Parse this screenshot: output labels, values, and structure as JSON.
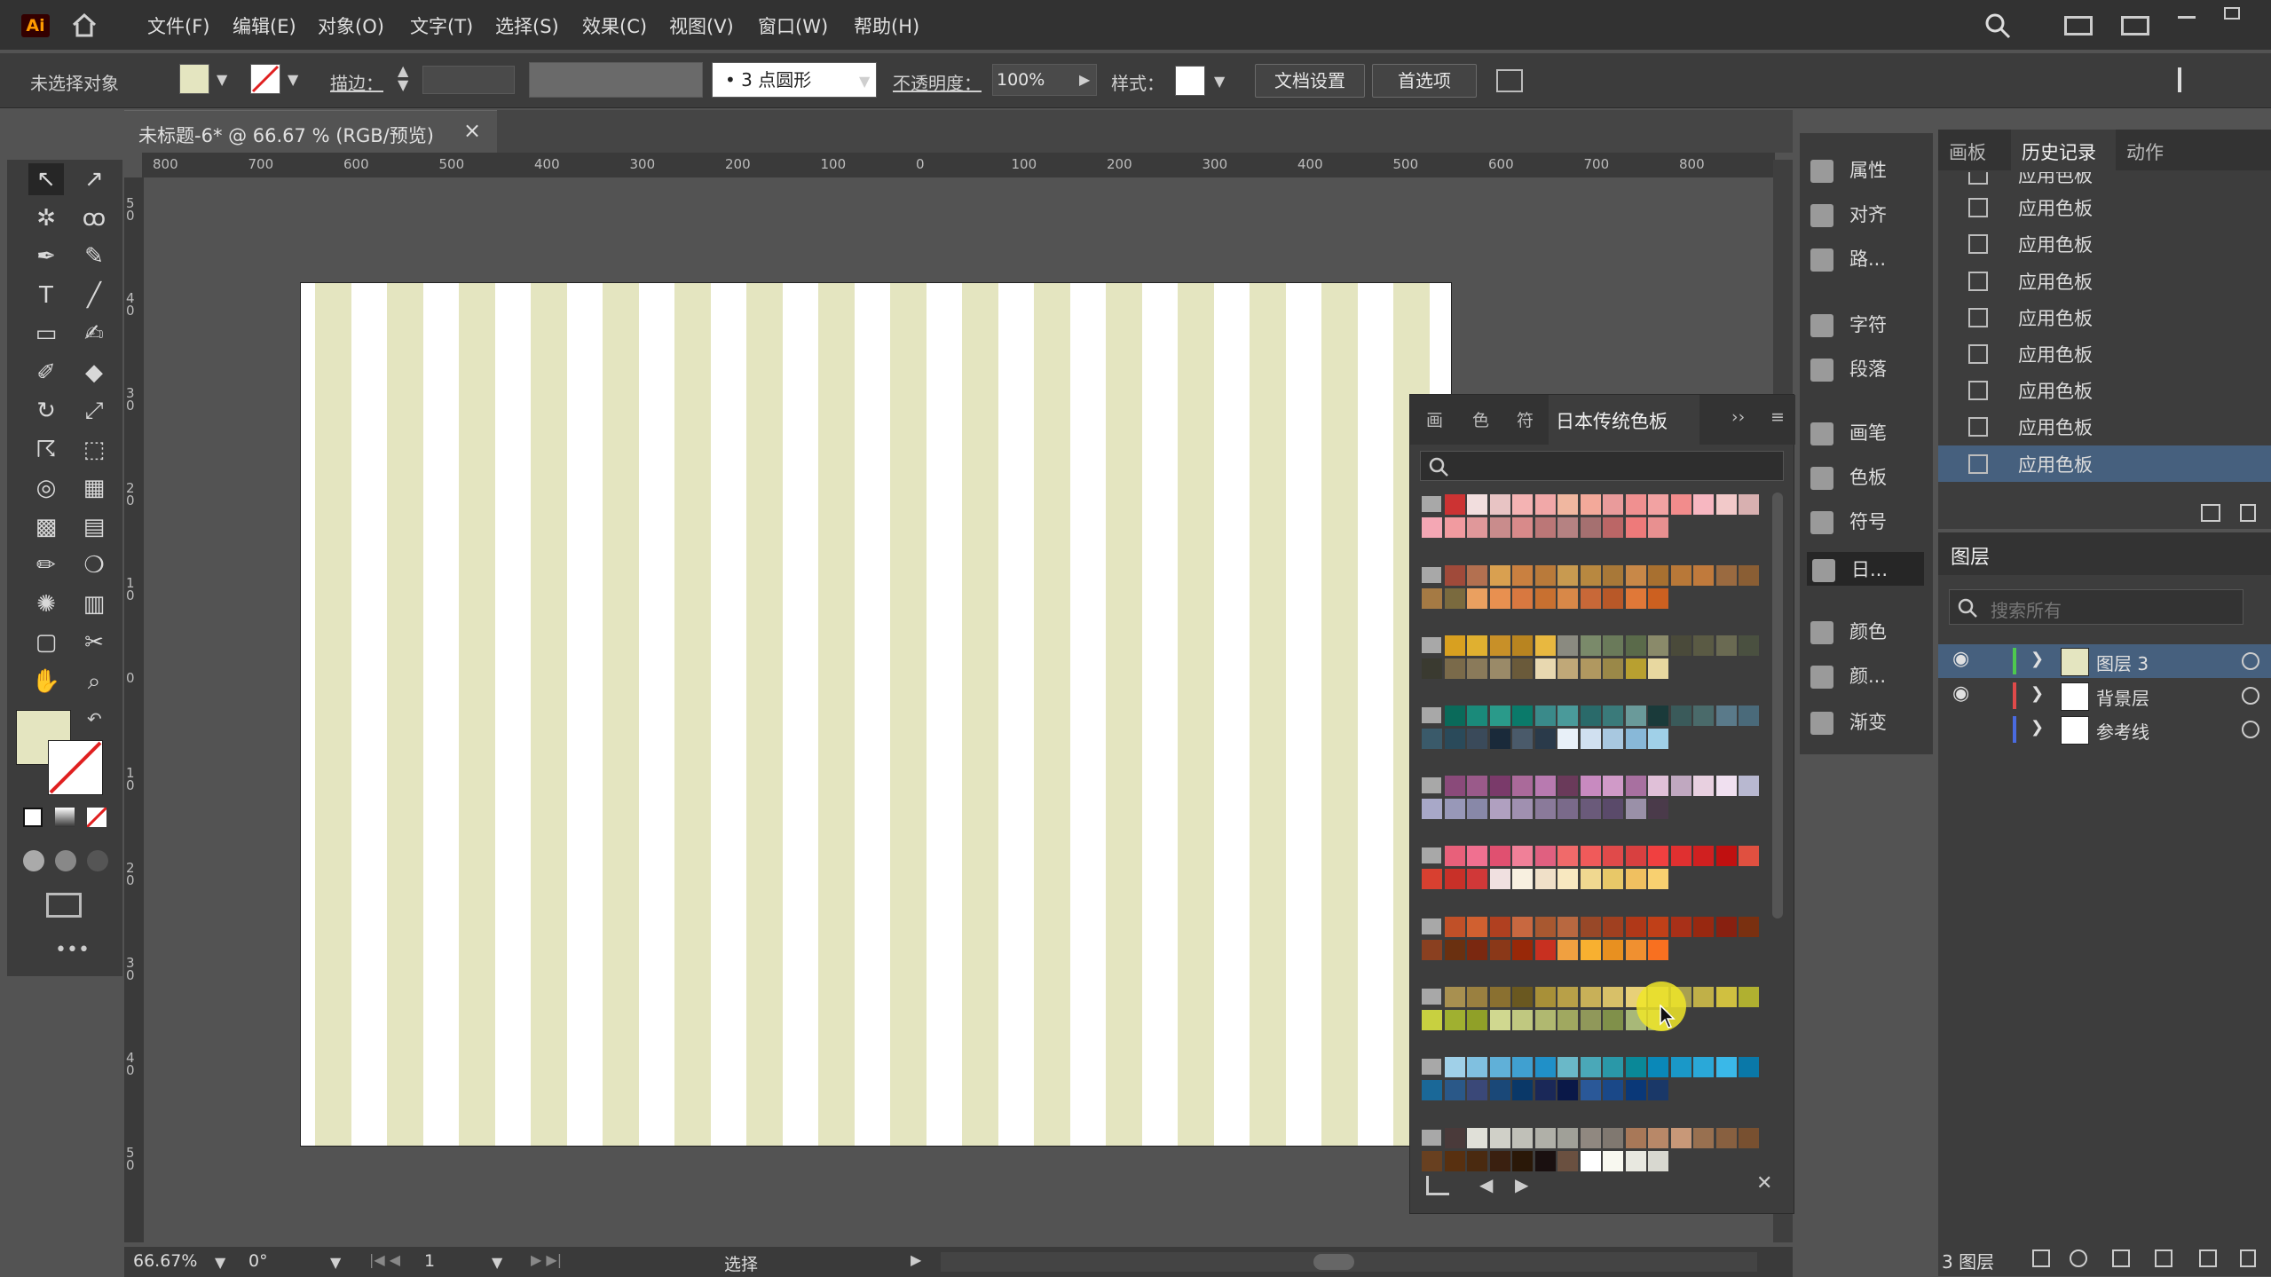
{
  "menubar": {
    "logo": "Ai",
    "items": [
      "文件(F)",
      "编辑(E)",
      "对象(O)",
      "文字(T)",
      "选择(S)",
      "效果(C)",
      "视图(V)",
      "窗口(W)",
      "帮助(H)"
    ]
  },
  "control_bar": {
    "no_selection": "未选择对象",
    "stroke_label": "描边：",
    "brush_label": "3 点圆形",
    "opacity_label": "不透明度：",
    "opacity_value": "100%",
    "style_label": "样式：",
    "doc_setup": "文档设置",
    "preferences": "首选项"
  },
  "document": {
    "tab_title": "未标题-6* @ 66.67 % (RGB/预览)",
    "close": "×",
    "ruler_top_labels": [
      "800",
      "700",
      "600",
      "500",
      "400",
      "300",
      "200",
      "100",
      "0",
      "100",
      "200",
      "300",
      "400",
      "500",
      "600",
      "700",
      "800"
    ],
    "ruler_left_labels": [
      "5 0",
      "4 0",
      "3 0",
      "2 0",
      "1 0",
      "0",
      "1 0",
      "2 0",
      "3 0",
      "4 0",
      "5 0"
    ],
    "stripe_color": "#e4e5c0"
  },
  "swatch_panel": {
    "tabs": [
      "画",
      "色",
      "符"
    ],
    "active_tab": "日本传统色板",
    "expand": "››",
    "menu": "≡",
    "search_icon": "search-icon"
  },
  "dock": {
    "items": [
      "属性",
      "对齐",
      "路...",
      "字符",
      "段落",
      "画笔",
      "色板",
      "符号",
      "日...",
      "颜色",
      "颜...",
      "渐变"
    ]
  },
  "history_panel": {
    "tabs": [
      "画板",
      "历史记录",
      "动作"
    ],
    "rows": [
      "应用色板",
      "应用色板",
      "应用色板",
      "应用色板",
      "应用色板",
      "应用色板",
      "应用色板",
      "应用色板",
      "应用色板"
    ]
  },
  "layers_panel": {
    "title": "图层",
    "search_placeholder": "搜索所有",
    "layers": [
      {
        "name": "图层 3",
        "color": "#4ec94e",
        "selected": true
      },
      {
        "name": "背景层",
        "color": "#e04a4a",
        "selected": false
      },
      {
        "name": "参考线",
        "color": "#4a6be0",
        "selected": false
      }
    ],
    "footer": "3 图层"
  },
  "status_bar": {
    "zoom": "66.67%",
    "rotation": "0°",
    "artboard_num": "1",
    "mode": "选择"
  }
}
